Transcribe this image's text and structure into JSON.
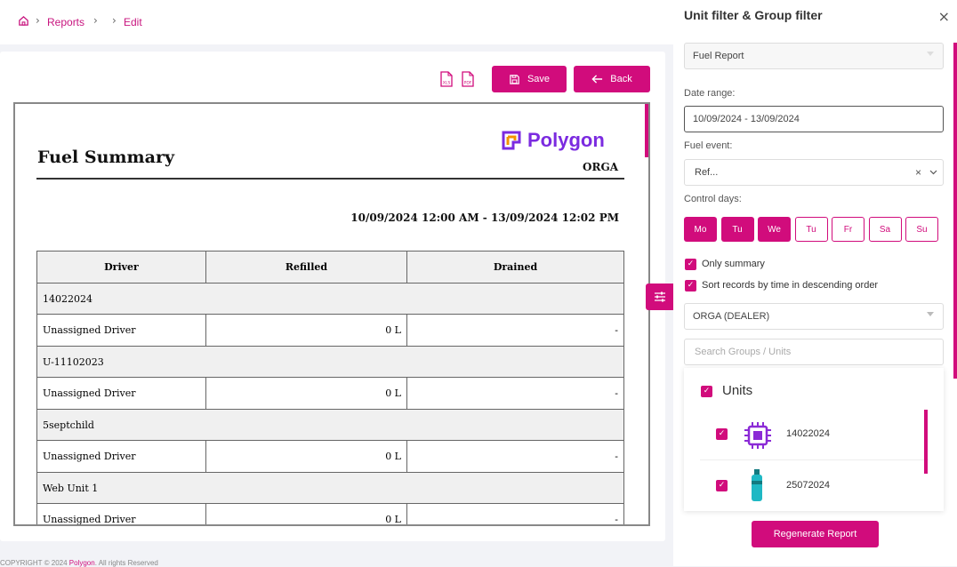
{
  "breadcrumb": {
    "home_icon": "home-icon",
    "reports": "Reports",
    "edit": "Edit"
  },
  "toolbar": {
    "save_label": "Save",
    "back_label": "Back",
    "xls_icon": "xls-file-icon",
    "pdf_icon": "pdf-file-icon"
  },
  "report": {
    "title": "Fuel Summary",
    "brand": "Polygon",
    "org": "ORGA",
    "date_range": "10/09/2024 12:00 AM - 13/09/2024 12:02 PM",
    "columns": [
      "Driver",
      "Refilled",
      "Drained"
    ],
    "groups": [
      {
        "name": "14022024",
        "driver": "Unassigned Driver",
        "refilled": "0 L",
        "drained": "-"
      },
      {
        "name": "U-11102023",
        "driver": "Unassigned Driver",
        "refilled": "0 L",
        "drained": "-"
      },
      {
        "name": "5septchild",
        "driver": "Unassigned Driver",
        "refilled": "0 L",
        "drained": "-"
      },
      {
        "name": "Web Unit 1",
        "driver": "Unassigned Driver",
        "refilled": "0 L",
        "drained": "-"
      }
    ]
  },
  "footer": {
    "copyright": "COPYRIGHT © 2024",
    "brand": "Polygon",
    "rights": ". All rights Reserved"
  },
  "panel": {
    "title": "Unit filter & Group filter",
    "report_type": "Fuel Report",
    "date_label": "Date range:",
    "date_value": "10/09/2024 - 13/09/2024",
    "event_label": "Fuel event:",
    "event_value": "Ref...",
    "control_label": "Control days:",
    "days": [
      {
        "label": "Mo",
        "on": true
      },
      {
        "label": "Tu",
        "on": true
      },
      {
        "label": "We",
        "on": true
      },
      {
        "label": "Tu",
        "on": false
      },
      {
        "label": "Fr",
        "on": false
      },
      {
        "label": "Sa",
        "on": false
      },
      {
        "label": "Su",
        "on": false
      }
    ],
    "only_summary": "Only summary",
    "sort_desc": "Sort records by time in descending order",
    "dealer": "ORGA (DEALER)",
    "search_placeholder": "Search Groups / Units",
    "units_label": "Units",
    "units": [
      {
        "name": "14022024",
        "icon": "chip-icon"
      },
      {
        "name": "25072024",
        "icon": "bottle-icon"
      }
    ],
    "regenerate_label": "Regenerate Report"
  },
  "colors": {
    "accent": "#d10c7c",
    "brand_purple": "#7b2be0",
    "brand_orange": "#f39200"
  }
}
